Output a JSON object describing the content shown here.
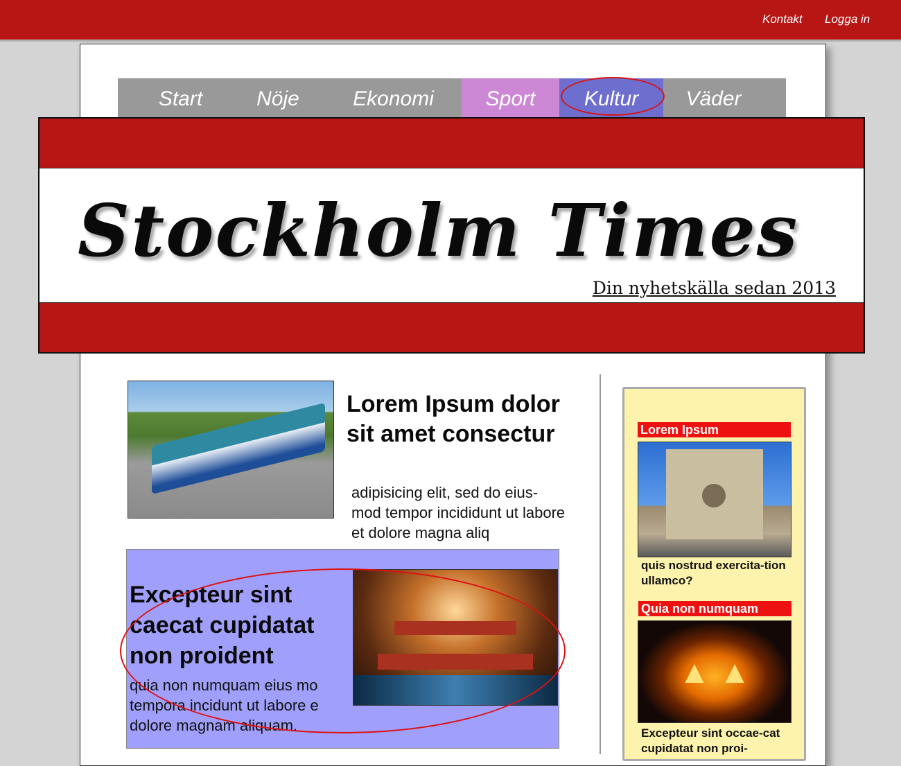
{
  "topbar": {
    "links": [
      "Kontakt",
      "Logga in"
    ]
  },
  "nav": {
    "items": [
      "Start",
      "Nöje",
      "Ekonomi",
      "Sport",
      "Kultur",
      "Väder"
    ]
  },
  "masthead": {
    "title": "Stockholm Times",
    "tagline": "Din nyhetskälla sedan 2013"
  },
  "article1": {
    "title": "Lorem Ipsum dolor sit amet consectur",
    "body": "adipisicing elit, sed do eius-mod tempor incididunt ut labore et dolore magna aliq"
  },
  "article2": {
    "title": "Excepteur sint caecat cupidatat non proident",
    "body": "quia non numquam eius mo tempora incidunt ut labore e dolore magnam aliquam."
  },
  "sidebar": {
    "items": [
      {
        "label": "Lorem Ipsum",
        "text": "quis nostrud exercita-tion ullamco?"
      },
      {
        "label": "Quia non numquam",
        "text": "Excepteur sint occae-cat cupidatat non proi-"
      }
    ]
  },
  "colors": {
    "brand_red": "#b81515",
    "nav_gray": "#999999",
    "nav_sport": "#cc88d4",
    "nav_kultur": "#6d6ecd",
    "feature_bg": "#a0a0fc",
    "sidebar_bg": "#fdf3ac",
    "annotation_circle": "#dd1111"
  }
}
